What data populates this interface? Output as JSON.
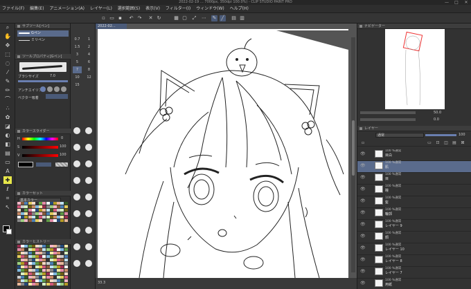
{
  "titlebar": {
    "title": "2022-02-19 … 7000px, 350dpi 100.0%) - CLIP STUDIO PAINT PRO",
    "controls": [
      "—",
      "□",
      "✕"
    ]
  },
  "menu": [
    "ファイル(F)",
    "編集(E)",
    "アニメーション(A)",
    "レイヤー(L)",
    "選択範囲(S)",
    "表示(V)",
    "フィルター(I)",
    "ウィンドウ(W)",
    "ヘルプ(H)"
  ],
  "subtool": {
    "group_title": "サブツール[ペン]",
    "items": [
      "Gペン",
      "ミリペン"
    ],
    "detail_title": "ツールプロパティ[Gペン]",
    "brush_size_label": "ブラシサイズ",
    "brush_size": "7.0",
    "antialias_label": "アンチエイリアス",
    "vector_label": "ベクター吸着"
  },
  "color_panel": {
    "title": "カラースライダー",
    "h_label": "H",
    "h_value": "0",
    "s_label": "S",
    "s_value": "100",
    "v_label": "V",
    "v_value": "100"
  },
  "palette": {
    "title": "カラーセット",
    "set_name": "基本カラー",
    "history_title": "カラーヒストリー"
  },
  "brush_sizes": [
    "0.7",
    "1",
    "1.5",
    "2",
    "3",
    "4",
    "5",
    "6",
    "7",
    "8",
    "10",
    "12",
    "15"
  ],
  "canvas": {
    "doc_tab": "2022-02...",
    "status_zoom": "33.3"
  },
  "navigator": {
    "title": "ナビゲーター",
    "zoom": "50.0",
    "angle": "0.0"
  },
  "layers": {
    "title": "レイヤー",
    "blend_mode": "通常",
    "opacity": "100",
    "rows": [
      {
        "blend": "100 %通常",
        "name": "目白",
        "selected": false
      },
      {
        "blend": "100 %通常",
        "name": "肌",
        "selected": true
      },
      {
        "blend": "100 %通常",
        "name": "目",
        "selected": false
      },
      {
        "blend": "100 %通常",
        "name": "瞳",
        "selected": false
      },
      {
        "blend": "100 %通常",
        "name": "髪",
        "selected": false
      },
      {
        "blend": "100 %通常",
        "name": "輪郭",
        "selected": false
      },
      {
        "blend": "100 %通常",
        "name": "レイヤー 9",
        "selected": false
      },
      {
        "blend": "100 %通常",
        "name": "顔",
        "selected": false
      },
      {
        "blend": "100 %通常",
        "name": "レイヤー 10",
        "selected": false
      },
      {
        "blend": "100 %通常",
        "name": "レイヤー 8",
        "selected": false
      },
      {
        "blend": "100 %通常",
        "name": "レイヤー 7",
        "selected": false
      },
      {
        "blend": "100 %通常",
        "name": "用紙",
        "selected": false
      }
    ]
  }
}
